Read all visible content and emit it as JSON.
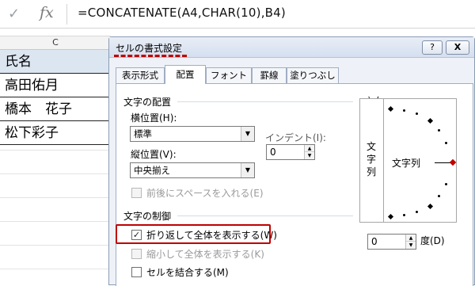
{
  "formula_bar": {
    "check_glyph": "✓",
    "fx": "fx",
    "formula": "=CONCATENATE(A4,CHAR(10),B4)"
  },
  "sheet": {
    "column_header": "C",
    "cells": [
      "氏名",
      "高田佑月",
      "橋本　花子",
      "松下彩子"
    ]
  },
  "dialog": {
    "title": "セルの書式設定",
    "help_label": "?",
    "close_label": "X",
    "tabs": [
      "表示形式",
      "配置",
      "フォント",
      "罫線",
      "塗りつぶし"
    ],
    "active_tab": "配置",
    "alignment": {
      "group_label": "文字の配置",
      "horizontal_label": "横位置(H):",
      "horizontal_value": "標準",
      "indent_label": "インデント(I):",
      "indent_value": "0",
      "vertical_label": "縦位置(V):",
      "vertical_value": "中央揃え",
      "distributed_label": "前後にスペースを入れる(E)"
    },
    "text_control": {
      "group_label": "文字の制御",
      "wrap_label": "折り返して全体を表示する(W)",
      "wrap_checked": true,
      "shrink_label": "縮小して全体を表示する(K)",
      "merge_label": "セルを結合する(M)"
    },
    "orientation": {
      "group_label": "方向",
      "vertical_text": "文字列",
      "horizontal_text": "文字列",
      "degrees_value": "0",
      "degrees_label": "度(D)"
    }
  },
  "colors": {
    "highlight": "#c00000",
    "selected_cell": "#dce6f1"
  }
}
